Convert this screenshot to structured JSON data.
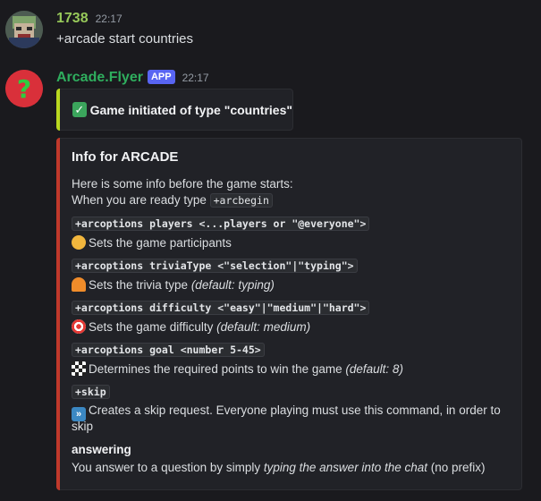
{
  "messages": [
    {
      "username": "1738",
      "timestamp": "22:17",
      "text": "+arcade start countries"
    },
    {
      "username": "Arcade.Flyer",
      "badge": "APP",
      "timestamp": "22:17"
    }
  ],
  "init_box": {
    "text": "Game initiated of type \"countries\"",
    "icon": "check-mark-button-icon",
    "accent": "#b9d820"
  },
  "embed": {
    "accent": "#c0392b",
    "title": "Info for ARCADE",
    "intro_line1": "Here is some info before the game starts:",
    "intro_line2_prefix": "When you are ready type ",
    "intro_line2_code": "+arcbegin",
    "options": [
      {
        "command": "+arcoptions players <...players or \"@everyone\">",
        "icon": "people-icon",
        "desc": "Sets the game participants",
        "default": ""
      },
      {
        "command": "+arcoptions triviaType <\"selection\"|\"typing\">",
        "icon": "bell-icon",
        "desc": "Sets the trivia type ",
        "default": "(default: typing)"
      },
      {
        "command": "+arcoptions difficulty <\"easy\"|\"medium\"|\"hard\">",
        "icon": "target-icon",
        "desc": "Sets the game difficulty ",
        "default": "(default: medium)"
      },
      {
        "command": "+arcoptions goal <number 5-45>",
        "icon": "checkered-flag-icon",
        "desc": "Determines the required points to win the game ",
        "default": "(default: 8)"
      },
      {
        "command": "+skip",
        "icon": "fast-forward-icon",
        "desc_line1": "Creates a skip request. Everyone playing must use this command, in order to",
        "desc_line2": "skip"
      }
    ],
    "answering_title": "answering",
    "answering_prefix": "You answer to a question by simply ",
    "answering_italic": "typing the answer into the chat",
    "answering_suffix": " (no prefix)"
  }
}
